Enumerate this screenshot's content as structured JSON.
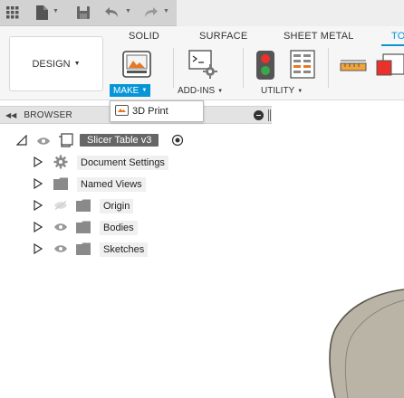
{
  "quick_access": {
    "icons": [
      "app-grid-icon",
      "file-icon",
      "save-icon",
      "undo-icon",
      "redo-icon"
    ]
  },
  "ribbon": {
    "workspace_button": "DESIGN",
    "tabs": [
      {
        "label": "SOLID",
        "active": false
      },
      {
        "label": "SURFACE",
        "active": false
      },
      {
        "label": "SHEET METAL",
        "active": false
      },
      {
        "label": "TO",
        "active": true
      }
    ],
    "groups": [
      {
        "label": "MAKE",
        "active": true
      },
      {
        "label": "ADD-INS",
        "active": false
      },
      {
        "label": "UTILITY",
        "active": false
      }
    ],
    "accent": "#0696d7"
  },
  "make_menu": {
    "items": [
      {
        "label": "3D Print",
        "icon": "3d-print-icon"
      }
    ]
  },
  "browser": {
    "title": "BROWSER",
    "root": {
      "label": "Slicer Table v3",
      "icon": "component-icon"
    },
    "items": [
      {
        "label": "Document Settings",
        "icon": "gear-icon",
        "visibility": "none"
      },
      {
        "label": "Named Views",
        "icon": "folder-icon",
        "visibility": "none"
      },
      {
        "label": "Origin",
        "icon": "folder-icon",
        "visibility": "hidden"
      },
      {
        "label": "Bodies",
        "icon": "folder-icon",
        "visibility": "visible"
      },
      {
        "label": "Sketches",
        "icon": "folder-icon",
        "visibility": "visible"
      }
    ]
  }
}
